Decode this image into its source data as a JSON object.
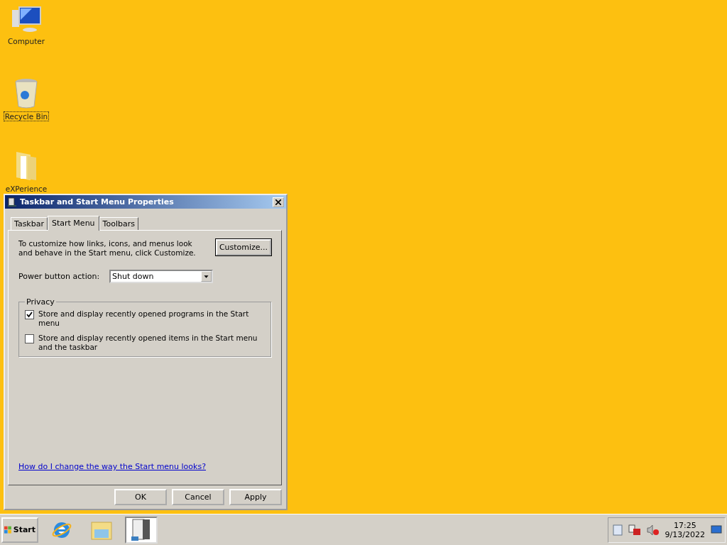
{
  "desktop_icons": [
    {
      "kind": "computer",
      "label": "Computer",
      "selected": false
    },
    {
      "kind": "bin",
      "label": "Recycle Bin",
      "selected": true
    },
    {
      "kind": "folder",
      "label": "eXPerience",
      "selected": false
    }
  ],
  "dialog": {
    "title": "Taskbar and Start Menu Properties",
    "tabs": [
      {
        "label": "Taskbar",
        "selected": false
      },
      {
        "label": "Start Menu",
        "selected": true
      },
      {
        "label": "Toolbars",
        "selected": false
      }
    ],
    "description": "To customize how links, icons, and menus look and behave in the Start menu, click Customize.",
    "customize_button": "Customize...",
    "power_button_action": {
      "label": "Power button action:",
      "value": "Shut down"
    },
    "privacy": {
      "title": "Privacy",
      "options": [
        {
          "label": "Store and display recently opened programs in the Start menu",
          "checked": true
        },
        {
          "label": "Store and display recently opened items in the Start menu and the taskbar",
          "checked": false
        }
      ]
    },
    "help_link": "How do I change the way the Start menu looks?",
    "buttons": [
      "OK",
      "Cancel",
      "Apply"
    ]
  },
  "taskbar": {
    "start": "Start",
    "apps": [
      {
        "kind": "browser",
        "selected": false
      },
      {
        "kind": "folder",
        "selected": false
      },
      {
        "kind": "server",
        "selected": true
      }
    ],
    "time": "17:25",
    "date": "9/13/2022"
  }
}
